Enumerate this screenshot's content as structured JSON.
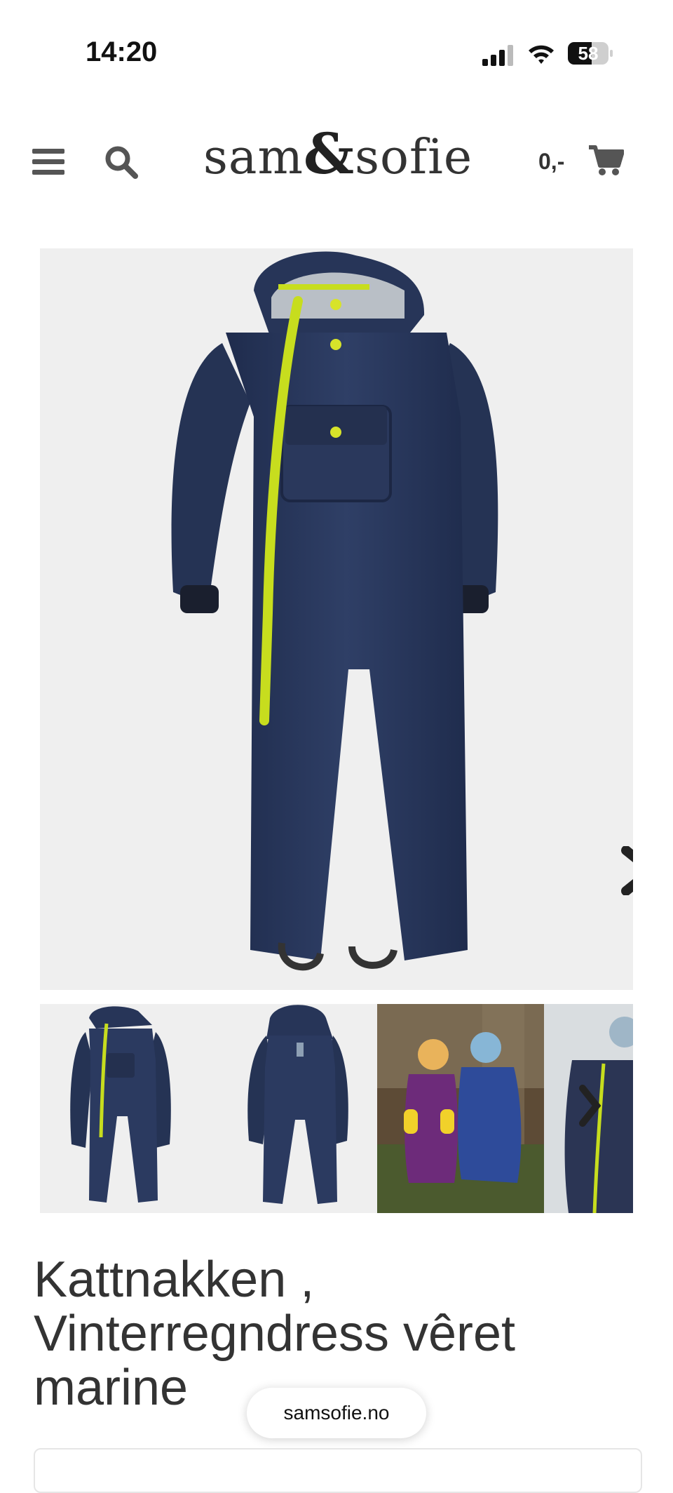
{
  "status_bar": {
    "time": "14:20",
    "battery_level": "58",
    "battery_fraction": 0.58,
    "icons": [
      "cellular-signal-icon",
      "wifi-icon",
      "battery-icon"
    ]
  },
  "header": {
    "logo": {
      "part1": "sam",
      "amp": "&",
      "part2": "sofie"
    },
    "cart_total": "0,-",
    "icons": [
      "menu-icon",
      "search-icon",
      "cart-icon"
    ]
  },
  "gallery": {
    "main_image_alt": "navy winter rain suit",
    "next_icon": "chevron-right-icon",
    "thumbnails": [
      {
        "alt": "suit front"
      },
      {
        "alt": "suit back"
      },
      {
        "alt": "two kids in rain suits"
      },
      {
        "alt": "child in rain suit"
      }
    ]
  },
  "product": {
    "title": "Kattnakken , Vinterregndress vêret marine"
  },
  "browser": {
    "url": "samsofie.no"
  },
  "colors": {
    "navy": "#273558",
    "accent_lime": "#c7dd1e",
    "text": "#333333",
    "image_bg": "#efefef"
  }
}
